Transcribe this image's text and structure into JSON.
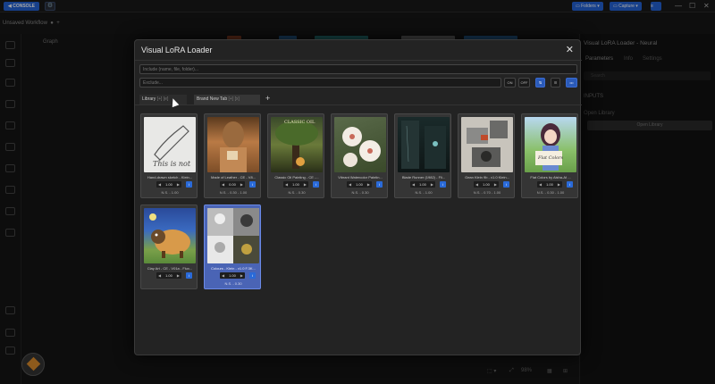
{
  "topbar": {
    "console_label": "CONSOLE",
    "folders_label": "Folders",
    "capture_label": "Capture"
  },
  "workflow": {
    "tab_title": "Unsaved Workflow",
    "graph_label": "Graph"
  },
  "right_panel": {
    "title": "Visual LoRA Loader - Neural",
    "tabs": [
      "Parameters",
      "Info",
      "Settings"
    ],
    "search_placeholder": "Search",
    "section": "INPUTS",
    "open_label": "Open Library",
    "open_button": "Open Library"
  },
  "modal": {
    "title": "Visual LoRA Loader",
    "include_placeholder": "Include (name, file, folder)...",
    "exclude_placeholder": "Exclude...",
    "on_label": "ON",
    "off_label": "OFF",
    "tabs": [
      {
        "label": "Library",
        "extra": "[+] [e]"
      },
      {
        "label": "Brand New Tab",
        "extra": "[+] [x]"
      }
    ],
    "add_tab": "+"
  },
  "cards": [
    {
      "title": "Hand-drawn sketch - Klein...",
      "strength": "1.00",
      "nstrength": "N.S. - 1.00",
      "selected": false
    },
    {
      "title": "Made of Leather - CE - V8...",
      "strength": "0.00",
      "nstrength": "N.S. - 0.30 - 1.00",
      "selected": false
    },
    {
      "title": "Classic Oil Painting - CE -...",
      "strength": "1.00",
      "nstrength": "N.S. - 0.30",
      "selected": false
    },
    {
      "title": "Vibrant Watercolor Paintin...",
      "strength": "1.00",
      "nstrength": "N.S. - 0.30",
      "selected": false
    },
    {
      "title": "Blade Runner (1982) - Fli...",
      "strength": "1.00",
      "nstrength": "N.S. - 1.00",
      "selected": false
    },
    {
      "title": "Gean Klein 9b - v1.0 Klein...",
      "strength": "1.00",
      "nstrength": "N.S. - 0.70 - 1.00",
      "selected": false
    },
    {
      "title": "Flat Colors by Aisha-AI ...",
      "strength": "1.00",
      "nstrength": "N.S. - 0.30 - 1.00",
      "selected": false
    },
    {
      "title": "Clay Art - CE - V01a - Flux...",
      "strength": "1.00",
      "nstrength": "",
      "selected": false
    },
    {
      "title": "Colours - Klein - v1.0 F.3K...",
      "strength": "1.00",
      "nstrength": "N.S. - 0.30",
      "selected": true
    }
  ],
  "bottom": {
    "zoom": "98%"
  },
  "colors": {
    "accent": "#2463d6",
    "selected_card": "#4a64b5"
  }
}
